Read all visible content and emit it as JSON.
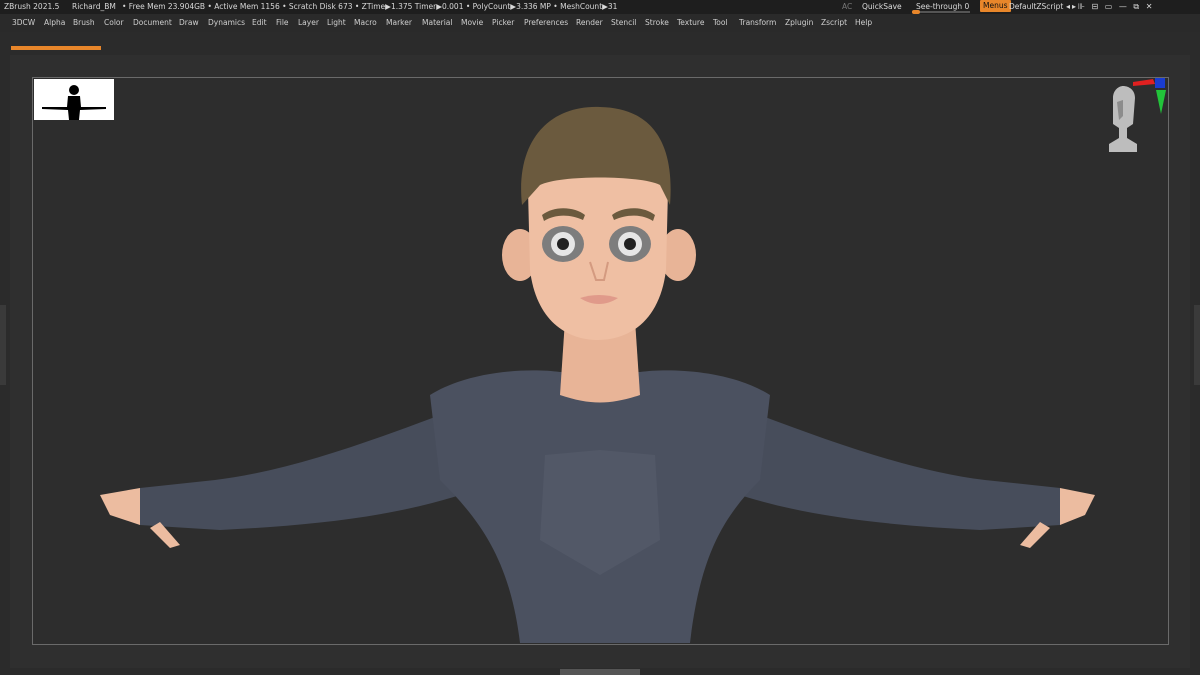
{
  "titlebar": {
    "app": "ZBrush 2021.5",
    "document": "Richard_BM",
    "status": "• Free Mem 23.904GB • Active Mem 1156 • Scratch Disk 673 • ZTime▶1.375 Timer▶0.001 • PolyCount▶3.336 MP • MeshCount▶31",
    "ac": "AC",
    "quicksave": "QuickSave",
    "seethrough": "See-through  0",
    "menus_toggle": "Menus",
    "script": "DefaultZScript",
    "window_icons": "◂▸⊪ ⊟ ▭ — ⧉ ✕"
  },
  "menus": [
    "3DCW",
    "Alpha",
    "Brush",
    "Color",
    "Document",
    "Draw",
    "Dynamics",
    "Edit",
    "File",
    "Layer",
    "Light",
    "Macro",
    "Marker",
    "Material",
    "Movie",
    "Picker",
    "Preferences",
    "Render",
    "Stencil",
    "Stroke",
    "Texture",
    "Tool",
    "Transform",
    "Zplugin",
    "Zscript",
    "Help"
  ],
  "colors": {
    "accent": "#e8862a",
    "background": "#2b2b2b",
    "canvas": "#2d2d2d",
    "skin": "#efbfa3",
    "hair": "#6b5a3e",
    "suit": "#4b5160"
  },
  "icons": {
    "thumbnail": "character-silhouette-icon",
    "navcube": "head-orientation-gizmo-icon"
  }
}
